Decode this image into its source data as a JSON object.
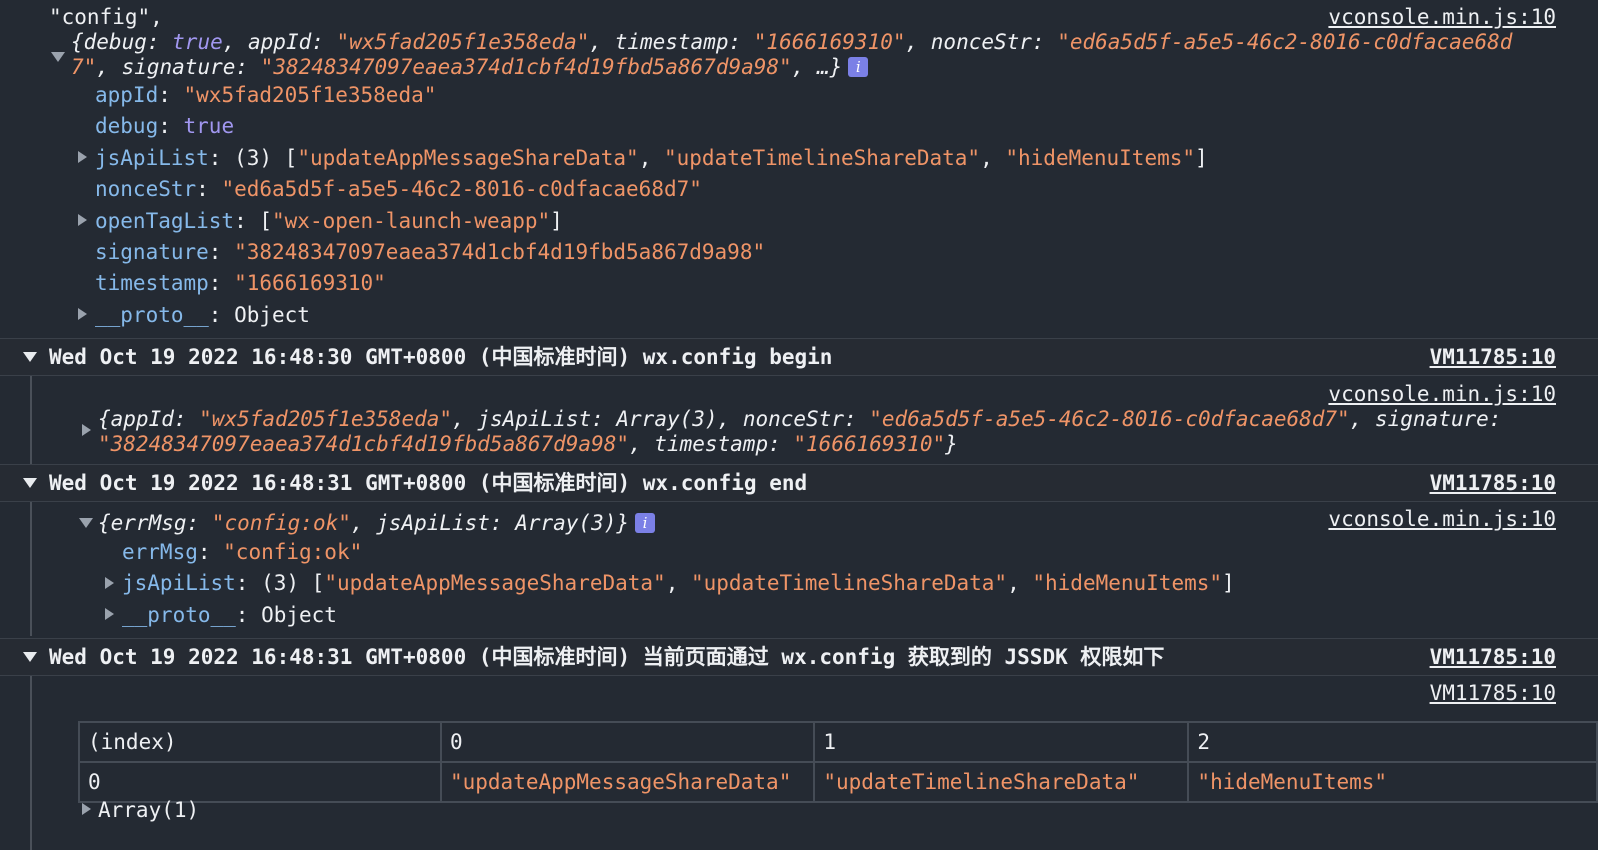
{
  "block1": {
    "config_label": "\"config\",",
    "source": "vconsole.min.js:10",
    "summary_line1": {
      "p1": "{debug: ",
      "debug_val": "true",
      "p2": ", appId: ",
      "appid_val": "\"wx5fad205f1e358eda\"",
      "p3": ", timestamp: ",
      "ts_val": "\"1666169310\"",
      "p4": ", nonceStr: ",
      "nonce_part1": "\"ed6a5d5f-a5e5-46c2-8016-c0dfacae68d"
    },
    "summary_line2": {
      "nonce_part2": "7\"",
      "p1": ", signature: ",
      "sig_val": "\"38248347097eaea374d1cbf4d19fbd5a867d9a98\"",
      "p2": ", …}"
    },
    "info_badge": "i",
    "props": {
      "appId_key": "appId",
      "appId_val": "\"wx5fad205f1e358eda\"",
      "debug_key": "debug",
      "debug_val": "true",
      "jsApiList_key": "jsApiList",
      "jsApiList_count": "(3)",
      "jsApiList_items": [
        "\"updateAppMessageShareData\"",
        "\"updateTimelineShareData\"",
        "\"hideMenuItems\""
      ],
      "nonceStr_key": "nonceStr",
      "nonceStr_val": "\"ed6a5d5f-a5e5-46c2-8016-c0dfacae68d7\"",
      "openTagList_key": "openTagList",
      "openTagList_item": "\"wx-open-launch-weapp\"",
      "signature_key": "signature",
      "signature_val": "\"38248347097eaea374d1cbf4d19fbd5a867d9a98\"",
      "timestamp_key": "timestamp",
      "timestamp_val": "\"1666169310\"",
      "proto_key": "__proto__",
      "proto_val": "Object"
    }
  },
  "group1": {
    "title": "Wed Oct 19 2022 16:48:30 GMT+0800 (中国标准时间) wx.config begin",
    "source": "VM11785:10",
    "inner_source": "vconsole.min.js:10",
    "line1": {
      "p1": "{appId: ",
      "appid_val": "\"wx5fad205f1e358eda\"",
      "p2": ", jsApiList: Array(3), nonceStr: ",
      "nonce_val": "\"ed6a5d5f-a5e5-46c2-8016-c0dfacae68d7\"",
      "p3": ", signature:"
    },
    "line2": {
      "sig_val": "\"38248347097eaea374d1cbf4d19fbd5a867d9a98\"",
      "p1": ", timestamp: ",
      "ts_val": "\"1666169310\"",
      "p2": "}"
    }
  },
  "group2": {
    "title": "Wed Oct 19 2022 16:48:31 GMT+0800 (中国标准时间) wx.config end",
    "source": "VM11785:10",
    "inner_source": "vconsole.min.js:10",
    "summary": {
      "p1": "{errMsg: ",
      "err_val": "\"config:ok\"",
      "p2": ", jsApiList: Array(3)}"
    },
    "info_badge": "i",
    "errMsg_key": "errMsg",
    "errMsg_val": "\"config:ok\"",
    "jsApiList_key": "jsApiList",
    "jsApiList_count": "(3)",
    "jsApiList_items": [
      "\"updateAppMessageShareData\"",
      "\"updateTimelineShareData\"",
      "\"hideMenuItems\""
    ],
    "proto_key": "__proto__",
    "proto_val": "Object"
  },
  "group3": {
    "title": "Wed Oct 19 2022 16:48:31 GMT+0800 (中国标准时间) 当前页面通过 wx.config 获取到的 JSSDK 权限如下",
    "source": "VM11785:10",
    "inner_source": "VM11785:10",
    "table": {
      "headers": [
        "(index)",
        "0",
        "1",
        "2"
      ],
      "rows": [
        [
          "0",
          "\"updateAppMessageShareData\"",
          "\"updateTimelineShareData\"",
          "\"hideMenuItems\""
        ]
      ]
    },
    "array_label": "Array(1)"
  }
}
